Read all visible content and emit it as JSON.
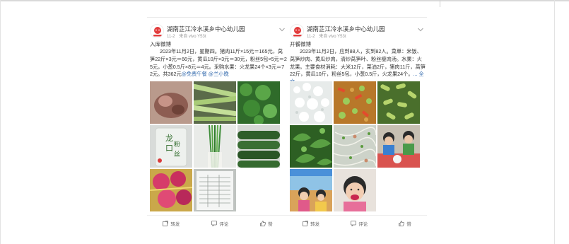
{
  "cards": [
    {
      "account": "湖南芷江冷水溪乡中心幼儿园",
      "date": "11-2",
      "device": "来自 vivo Y53t",
      "title": "入库微博",
      "body": "2023年11月2日，星期四。猪肉11斤×15元＝165元，莴笋22斤×3元＝66元，黄瓜10斤×3元＝30元，粉丝5包×5元＝25元，小葱0.5斤×8元＝4元。采购水果：火龙果24个×3元＝72元。共362元",
      "tag1": "@免费午餐",
      "tag2": "@兰小晚",
      "actions": {
        "repost": "转发",
        "comment": "评论",
        "like": "赞"
      }
    },
    {
      "account": "湖南芷江冷水溪乡中心幼儿园",
      "date": "11-2",
      "device": "来自 vivo Y53t",
      "title": "开餐微博",
      "body": "2023年11月2日，应到88人，实到82人。菜单：米饭、莴笋炒肉、黄瓜炒肉，清炒莴笋叶、粉丝瘦肉汤。水果：火龙果。主要食材消耗：大米12斤，菜油2斤，猪肉11斤，莴笋22斤，黄瓜10斤，粉丝5包，小葱0.5斤，火龙果24个。",
      "more": "... 全文",
      "actions": {
        "repost": "转发",
        "comment": "评论",
        "like": "赞"
      }
    }
  ],
  "icons": [
    "avatar-logo-icon",
    "chevron-down-icon",
    "repost-icon",
    "comment-icon",
    "like-icon"
  ],
  "colors": {
    "link": "#3a6fb0",
    "muted": "#999999",
    "text": "#333333"
  }
}
